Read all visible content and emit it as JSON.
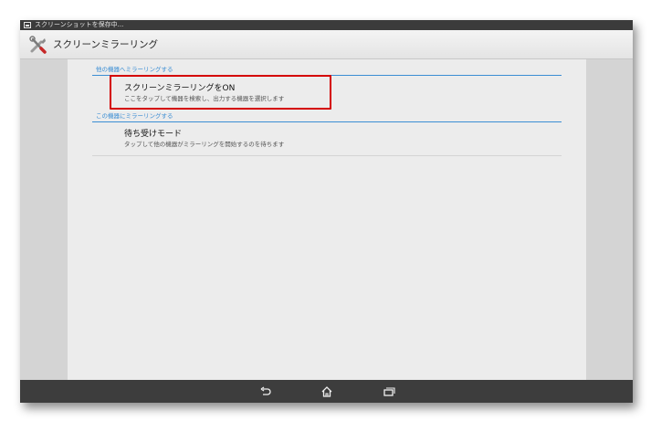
{
  "status_bar": {
    "text": "スクリーンショットを保存中..."
  },
  "action_bar": {
    "title": "スクリーンミラーリング",
    "icon": "tools-icon"
  },
  "sections": [
    {
      "header": "他の機器へミラーリングする",
      "items": [
        {
          "title": "スクリーンミラーリングをON",
          "subtitle": "ここをタップして機器を検索し、出力する機器を選択します"
        }
      ]
    },
    {
      "header": "この機器にミラーリングする",
      "items": [
        {
          "title": "待ち受けモード",
          "subtitle": "タップして他の機器がミラーリングを開始するのを待ちます"
        }
      ]
    }
  ],
  "nav_bar": {
    "buttons": [
      "back-icon",
      "home-icon",
      "recent-apps-icon"
    ]
  },
  "colors": {
    "accent": "#3b8ed4",
    "highlight": "#d40000",
    "nav_bg": "#3d3d3d"
  }
}
